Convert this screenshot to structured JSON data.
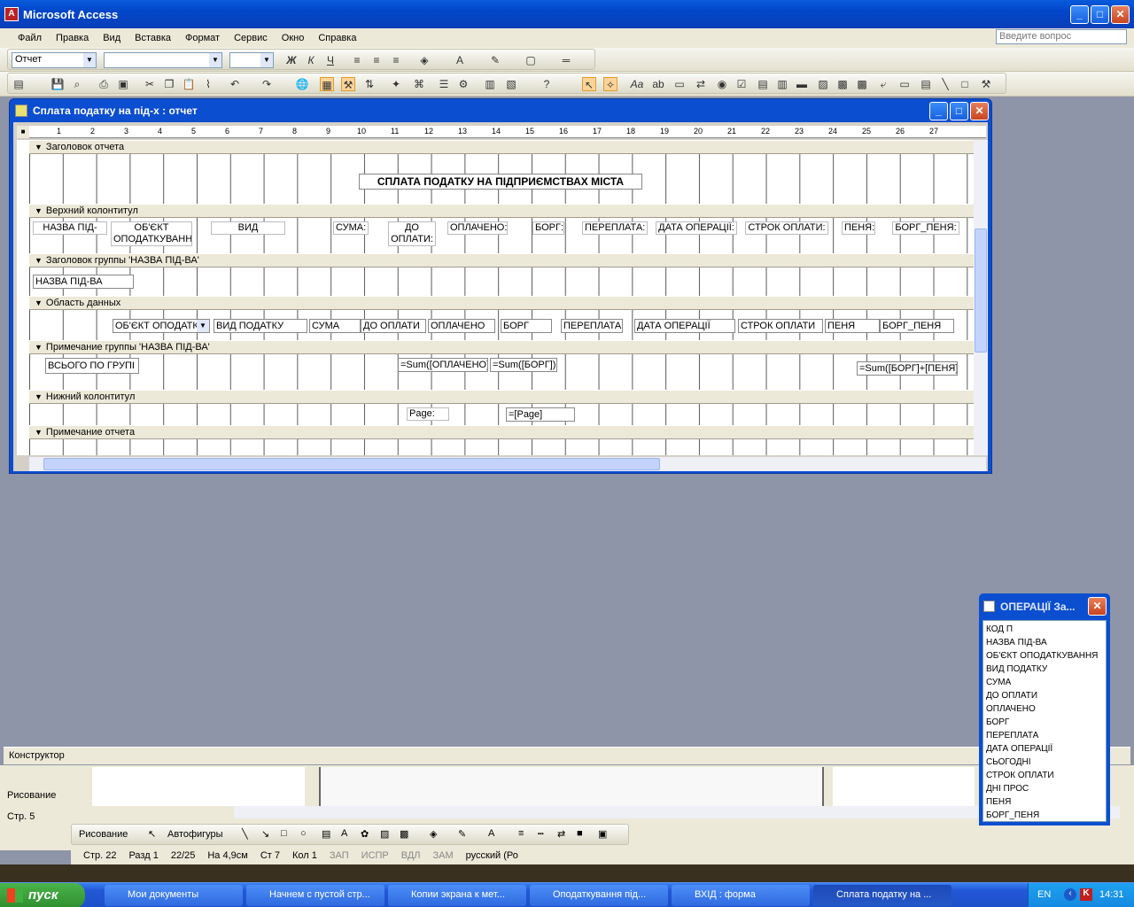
{
  "app": {
    "title": "Microsoft Access"
  },
  "menu": [
    "Файл",
    "Правка",
    "Вид",
    "Вставка",
    "Формат",
    "Сервис",
    "Окно",
    "Справка"
  ],
  "help_placeholder": "Введите вопрос",
  "toolbar": {
    "object_combo": "Отчет",
    "format_buttons": [
      "Ж",
      "К",
      "Ч"
    ]
  },
  "report": {
    "title": "Сплата податку на під-х : отчет",
    "ruler": [
      "1",
      "2",
      "3",
      "4",
      "5",
      "6",
      "7",
      "8",
      "9",
      "10",
      "11",
      "12",
      "13",
      "14",
      "15",
      "16",
      "17",
      "18",
      "19",
      "20",
      "21",
      "22",
      "23",
      "24",
      "25",
      "26",
      "27"
    ],
    "sections": {
      "report_header": "Заголовок отчета",
      "page_header": "Верхний колонтитул",
      "group_header": "Заголовок группы 'НАЗВА ПІД-ВА'",
      "detail": "Область данных",
      "group_footer": "Примечание группы 'НАЗВА ПІД-ВА'",
      "page_footer": "Нижний колонтитул",
      "report_footer": "Примечание отчета"
    },
    "report_title": "СПЛАТА ПОДАТКУ НА ПІДПРИЄМСТВАХ МІСТА",
    "header_labels": [
      "НАЗВА ПІД-ВА:",
      "ОБ'ЄКТ ОПОДАТКУВАННЯ:",
      "ВИД ПОДАТКУ:",
      "СУМА:",
      "ДО ОПЛАТИ:",
      "ОПЛАЧЕНО:",
      "БОРГ:",
      "ПЕРЕПЛАТА:",
      "ДАТА ОПЕРАЦІЇ:",
      "СТРОК ОПЛАТИ:",
      "ПЕНЯ:",
      "БОРГ_ПЕНЯ:"
    ],
    "group_field": "НАЗВА ПІД-ВА",
    "detail_fields": [
      "ОБ'ЄКТ ОПОДАТК",
      "ВИД ПОДАТКУ",
      "СУМА",
      "ДО ОПЛАТИ",
      "ОПЛАЧЕНО",
      "БОРГ",
      "ПЕРЕПЛАТА",
      "ДАТА ОПЕРАЦІЇ",
      "СТРОК ОПЛАТИ",
      "ПЕНЯ",
      "БОРГ_ПЕНЯ"
    ],
    "footer": {
      "total_label": "ВСЬОГО ПО ГРУПІ",
      "sum_paid": "=Sum([ОПЛАЧЕНО])",
      "sum_debt": "=Sum([БОРГ])",
      "sum_total": "=Sum([БОРГ]+[ПЕНЯ])"
    },
    "page_footer": {
      "label": "Page:",
      "expr": "=[Page]"
    }
  },
  "status": {
    "mode": "Конструктор"
  },
  "word": {
    "page": "Стр. 5",
    "drawing": "Рисование",
    "autoshapes": "Автофигуры",
    "status_line": [
      "Стр. 22",
      "Разд 1",
      "22/25",
      "На 4,9см",
      "Ст 7",
      "Кол 1",
      "ЗАП",
      "ИСПР",
      "ВДЛ",
      "ЗАМ",
      "русский (Ро"
    ]
  },
  "field_list": {
    "title": "ОПЕРАЦІЇ За...",
    "fields": [
      "КОД П",
      "НАЗВА ПІД-ВА",
      "ОБ'ЄКТ ОПОДАТКУВАННЯ",
      "ВИД ПОДАТКУ",
      "СУМА",
      "ДО ОПЛАТИ",
      "ОПЛАЧЕНО",
      "БОРГ",
      "ПЕРЕПЛАТА",
      "ДАТА ОПЕРАЦІЇ",
      "СЬОГОДНІ",
      "СТРОК ОПЛАТИ",
      "ДНІ ПРОС",
      "ПЕНЯ",
      "БОРГ_ПЕНЯ"
    ]
  },
  "taskbar": {
    "start": "пуск",
    "tasks": [
      "Мои документы",
      "Начнем с пустой стр...",
      "Копии экрана к мет...",
      "Оподаткування під...",
      "ВХІД : форма",
      "Сплата податку на ..."
    ],
    "lang": "EN",
    "time": "14:31"
  }
}
